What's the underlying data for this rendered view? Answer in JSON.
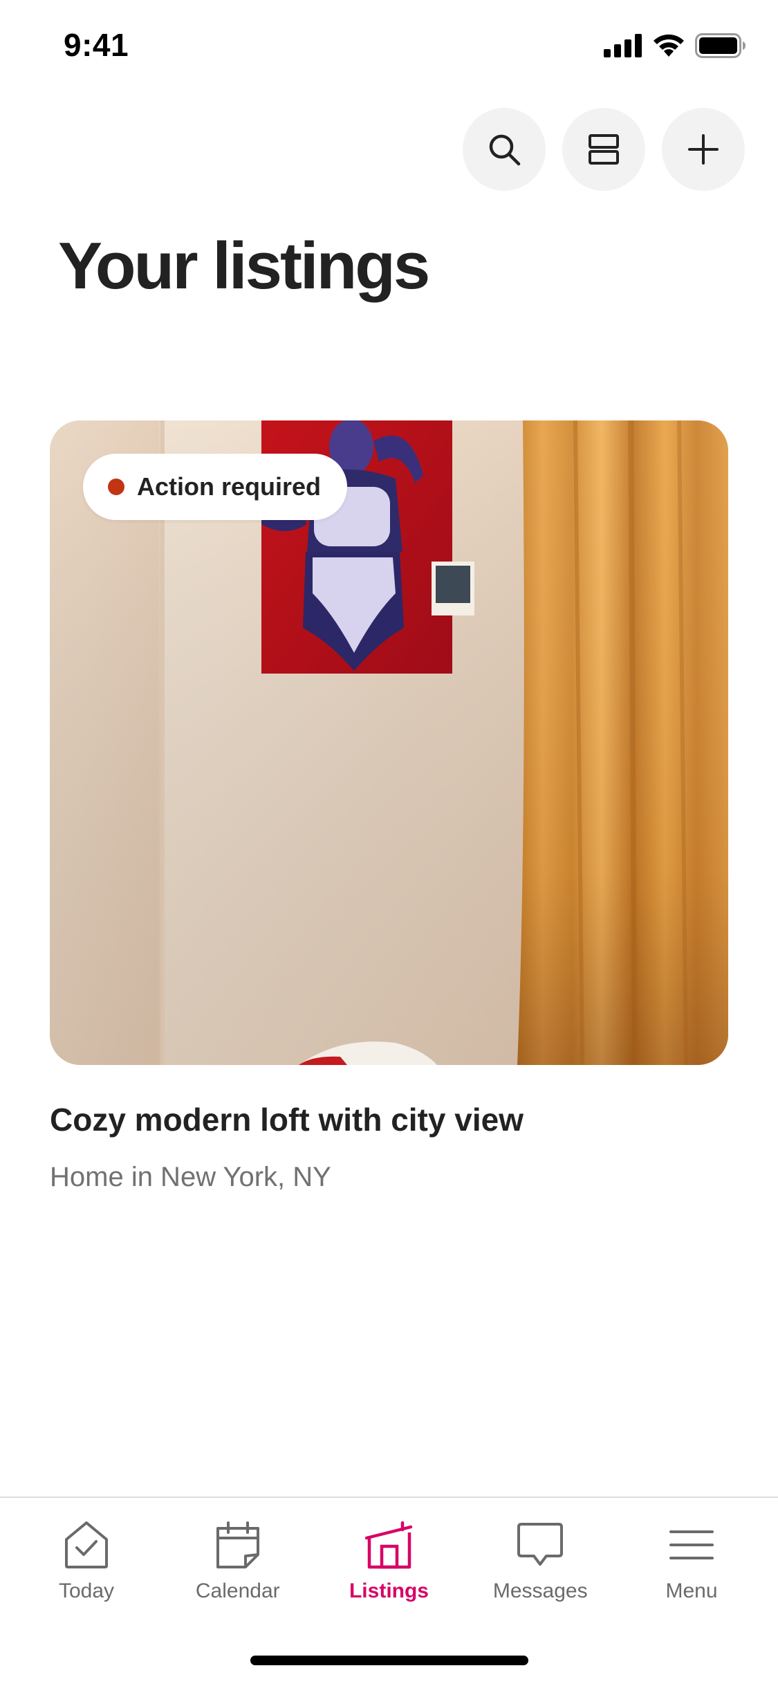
{
  "status_bar": {
    "time": "9:41"
  },
  "toolbar": {
    "buttons": [
      {
        "icon": "search-icon"
      },
      {
        "icon": "layout-icon"
      },
      {
        "icon": "plus-icon"
      }
    ]
  },
  "page": {
    "title": "Your listings"
  },
  "listing": {
    "badge_label": "Action required",
    "badge_color": "#c13515",
    "title": "Cozy modern loft with city view",
    "subtitle": "Home in New York, NY"
  },
  "tab_bar": {
    "active_color": "#d70466",
    "inactive_color": "#6a6a6a",
    "tabs": [
      {
        "label": "Today",
        "icon": "today-icon",
        "active": false
      },
      {
        "label": "Calendar",
        "icon": "calendar-icon",
        "active": false
      },
      {
        "label": "Listings",
        "icon": "listings-icon",
        "active": true
      },
      {
        "label": "Messages",
        "icon": "messages-icon",
        "active": false
      },
      {
        "label": "Menu",
        "icon": "menu-icon",
        "active": false
      }
    ]
  }
}
